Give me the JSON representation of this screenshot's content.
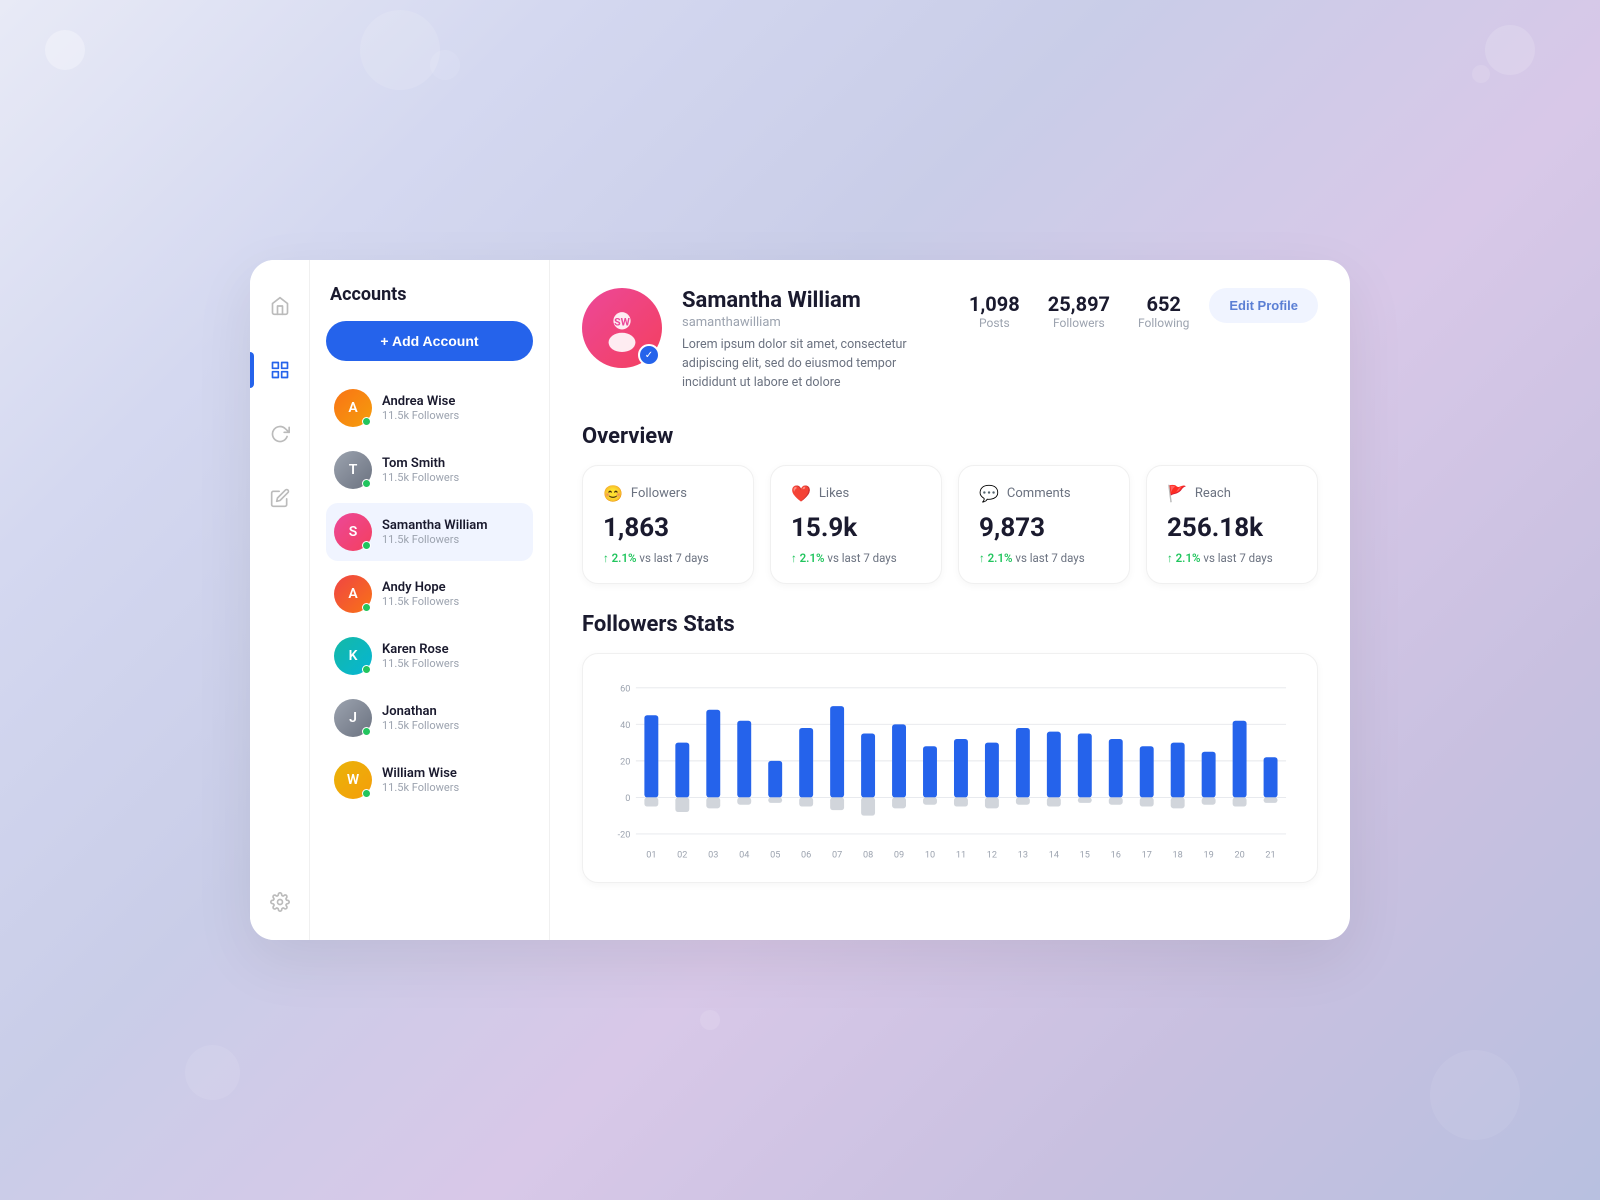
{
  "background": {
    "gradient": "135deg, #e8eaf6 0%, #d0d4ee 30%, #ccc4e4 60%, #bdc5e4 100%"
  },
  "sidebar": {
    "icons": [
      {
        "name": "home",
        "symbol": "⌂",
        "active": false
      },
      {
        "name": "dashboard",
        "symbol": "⊞",
        "active": true
      },
      {
        "name": "refresh",
        "symbol": "↻",
        "active": false
      },
      {
        "name": "edit",
        "symbol": "✏",
        "active": false
      },
      {
        "name": "settings",
        "symbol": "⚙",
        "active": false
      }
    ]
  },
  "accounts": {
    "title": "Accounts",
    "add_button_label": "+ Add Account",
    "items": [
      {
        "name": "Andrea Wise",
        "followers": "11.5k Followers",
        "color": "av-orange",
        "online": true,
        "initial": "A"
      },
      {
        "name": "Tom Smith",
        "followers": "11.5k Followers",
        "color": "av-gray",
        "online": true,
        "initial": "T"
      },
      {
        "name": "Samantha William",
        "followers": "11.5k Followers",
        "color": "av-pink",
        "online": true,
        "initial": "S",
        "active": true
      },
      {
        "name": "Andy Hope",
        "followers": "11.5k Followers",
        "color": "av-red",
        "online": true,
        "initial": "A"
      },
      {
        "name": "Karen Rose",
        "followers": "11.5k Followers",
        "color": "av-teal",
        "online": true,
        "initial": "K"
      },
      {
        "name": "Jonathan",
        "followers": "11.5k Followers",
        "color": "av-gray",
        "online": true,
        "initial": "J"
      },
      {
        "name": "William Wise",
        "followers": "11.5k Followers",
        "color": "av-yellow",
        "online": true,
        "initial": "W"
      }
    ]
  },
  "profile": {
    "name": "Samantha William",
    "handle": "samanthawilliam",
    "bio": "Lorem ipsum dolor sit amet, consectetur adipiscing elit, sed do eiusmod tempor incididunt ut labore et dolore",
    "stats": {
      "posts": {
        "value": "1,098",
        "label": "Posts"
      },
      "followers": {
        "value": "25,897",
        "label": "Followers"
      },
      "following": {
        "value": "652",
        "label": "Following"
      }
    },
    "edit_button": "Edit Profile"
  },
  "overview": {
    "title": "Overview",
    "cards": [
      {
        "icon": "😊",
        "label": "Followers",
        "value": "1,863",
        "trend_percent": "2.1%",
        "trend_label": "vs last 7 days",
        "trend_color": "#22c55e"
      },
      {
        "icon": "❤️",
        "label": "Likes",
        "value": "15.9k",
        "trend_percent": "2.1%",
        "trend_label": "vs last 7 days",
        "trend_color": "#22c55e"
      },
      {
        "icon": "💬",
        "label": "Comments",
        "value": "9,873",
        "trend_percent": "2.1%",
        "trend_label": "vs last 7 days",
        "trend_color": "#22c55e"
      },
      {
        "icon": "🚩",
        "label": "Reach",
        "value": "256.18k",
        "trend_percent": "2.1%",
        "trend_label": "vs last 7 days",
        "trend_color": "#22c55e"
      }
    ]
  },
  "chart": {
    "title": "Followers Stats",
    "y_labels": [
      "60",
      "40",
      "20",
      "0",
      "-20"
    ],
    "x_labels": [
      "01",
      "02",
      "03",
      "04",
      "05",
      "06",
      "07",
      "08",
      "09",
      "10",
      "11",
      "12",
      "13",
      "14",
      "15",
      "16",
      "17",
      "18",
      "19",
      "20",
      "21"
    ],
    "bars": [
      {
        "value": 45,
        "neg": 5
      },
      {
        "value": 30,
        "neg": 8
      },
      {
        "value": 48,
        "neg": 6
      },
      {
        "value": 42,
        "neg": 4
      },
      {
        "value": 20,
        "neg": 3
      },
      {
        "value": 38,
        "neg": 5
      },
      {
        "value": 50,
        "neg": 7
      },
      {
        "value": 35,
        "neg": 10
      },
      {
        "value": 40,
        "neg": 6
      },
      {
        "value": 28,
        "neg": 4
      },
      {
        "value": 32,
        "neg": 5
      },
      {
        "value": 30,
        "neg": 6
      },
      {
        "value": 38,
        "neg": 4
      },
      {
        "value": 36,
        "neg": 5
      },
      {
        "value": 35,
        "neg": 3
      },
      {
        "value": 32,
        "neg": 4
      },
      {
        "value": 28,
        "neg": 5
      },
      {
        "value": 30,
        "neg": 6
      },
      {
        "value": 25,
        "neg": 4
      },
      {
        "value": 42,
        "neg": 5
      },
      {
        "value": 22,
        "neg": 3
      }
    ]
  }
}
